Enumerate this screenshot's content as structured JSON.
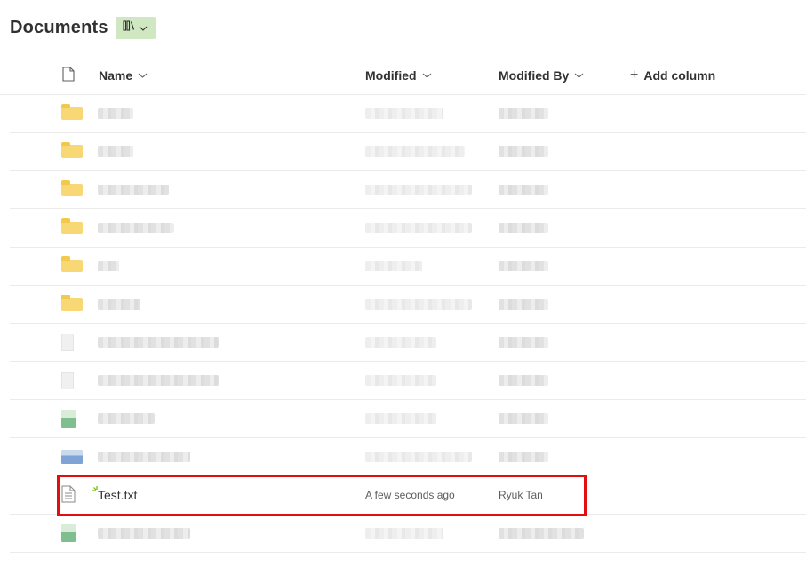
{
  "library": {
    "title": "Documents"
  },
  "columns": {
    "name": "Name",
    "modified": "Modified",
    "modified_by": "Modified By",
    "add_column": "Add column"
  },
  "highlighted_file": {
    "name": "Test.txt",
    "modified": "A few seconds ago",
    "modified_by": "Ryuk Tan",
    "icon": "text-file-icon"
  },
  "rows": [
    {
      "type": "folder"
    },
    {
      "type": "folder"
    },
    {
      "type": "folder"
    },
    {
      "type": "folder"
    },
    {
      "type": "folder"
    },
    {
      "type": "folder"
    },
    {
      "type": "file"
    },
    {
      "type": "file"
    },
    {
      "type": "spreadsheet"
    },
    {
      "type": "document"
    },
    {
      "type": "text-file"
    },
    {
      "type": "spreadsheet"
    }
  ],
  "colors": {
    "highlight": "#e01010",
    "view_switcher_bg": "#cfe8c2"
  }
}
